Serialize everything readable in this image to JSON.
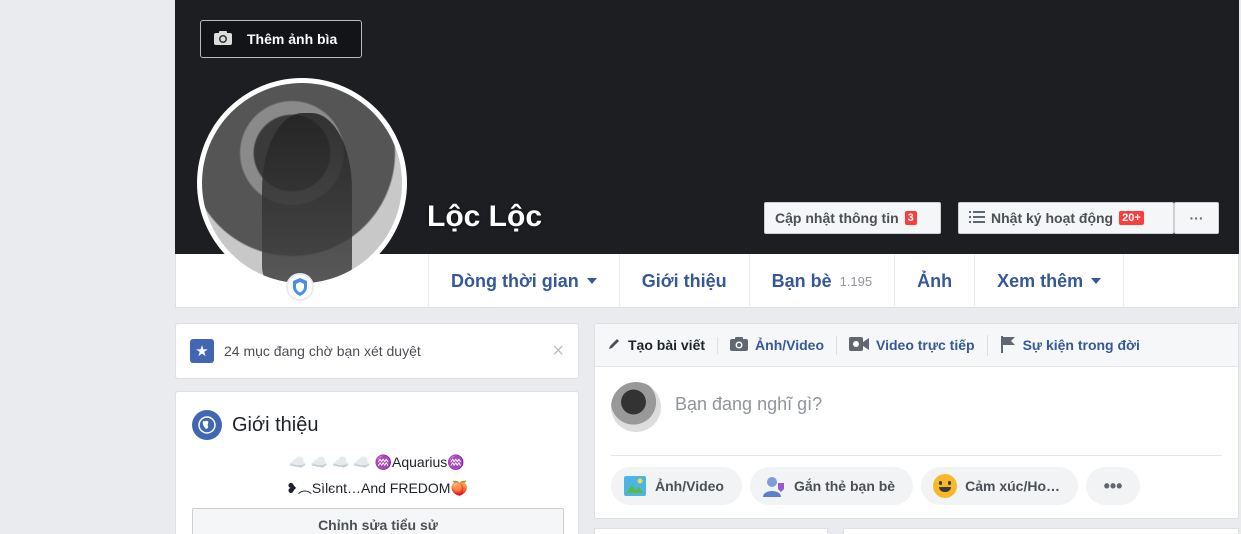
{
  "cover": {
    "add_cover_label": "Thêm ảnh bìa"
  },
  "profile": {
    "name": "Lộc Lộc"
  },
  "cover_buttons": {
    "update_info_label": "Cập nhật thông tin",
    "update_info_badge": "3",
    "activity_log_label": "Nhật ký hoạt động",
    "activity_log_badge": "20+",
    "more_label": "···"
  },
  "nav": {
    "timeline": "Dòng thời gian",
    "about": "Giới thiệu",
    "friends": "Bạn bè",
    "friends_count": "1.195",
    "photos": "Ảnh",
    "more": "Xem thêm"
  },
  "pending": {
    "text": "24 mục đang chờ bạn xét duyệt",
    "close": "×"
  },
  "intro": {
    "title": "Giới thiệu",
    "bio_line1": "☁️      ☁️      ☁️       ☁️       ♒Aquarius♒",
    "bio_line2": "❥︵Sìlєnt…And FREDOM🍑",
    "edit_bio_label": "Chỉnh sửa tiểu sử"
  },
  "composer": {
    "tabs": {
      "create_post": "Tạo bài viết",
      "photo_video": "Ảnh/Video",
      "live_video": "Video trực tiếp",
      "life_event": "Sự kiện trong đời"
    },
    "placeholder": "Bạn đang nghĩ gì?",
    "chips": {
      "photo_video": "Ảnh/Video",
      "tag_friends": "Gắn thẻ bạn bè",
      "feeling": "Cảm xúc/Ho…",
      "more": "•••"
    }
  },
  "colors": {
    "link_blue": "#365899",
    "badge_red": "#fa3e3e",
    "cover_dark": "#1c1e21"
  }
}
